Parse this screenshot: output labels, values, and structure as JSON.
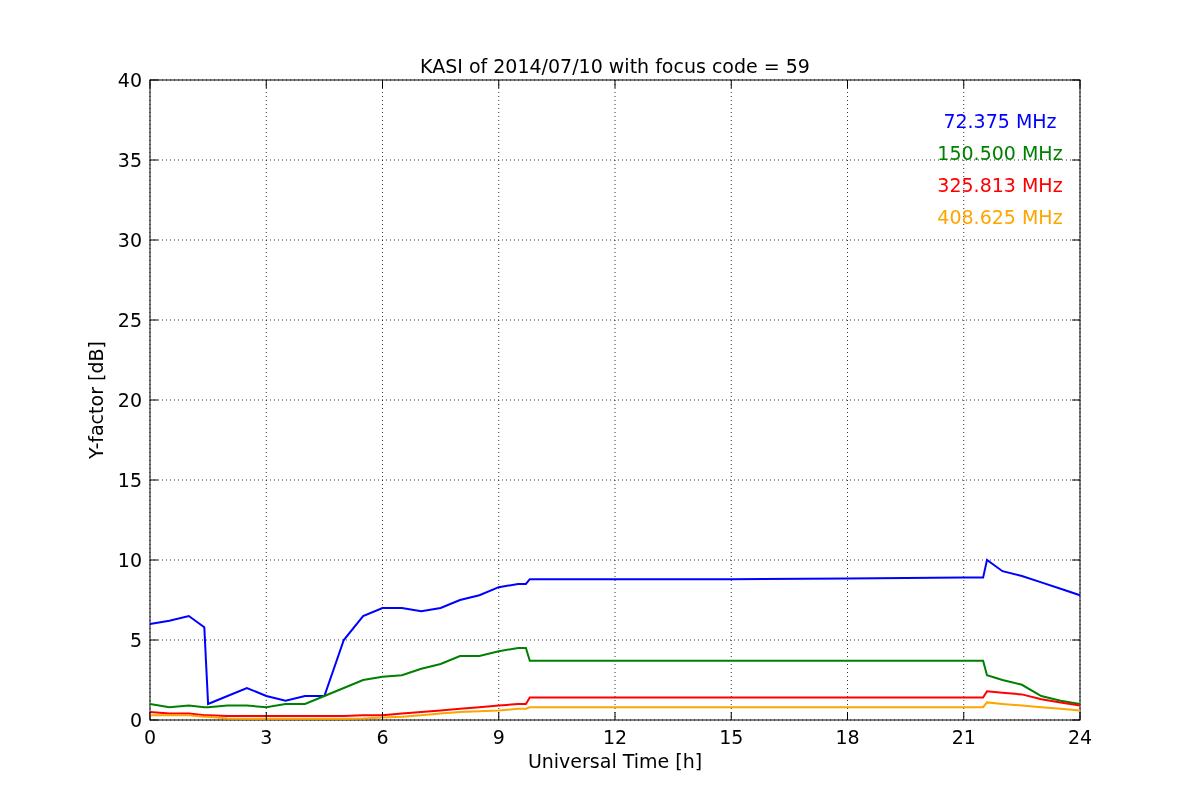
{
  "chart_data": {
    "type": "line",
    "title": "KASI of 2014/07/10 with focus code = 59",
    "xlabel": "Universal Time [h]",
    "ylabel": "Y-factor [dB]",
    "x": [
      0,
      0.5,
      1,
      1.4,
      1.5,
      2,
      2.5,
      3,
      3.5,
      4,
      4.5,
      5,
      5.5,
      6,
      6.5,
      7,
      7.5,
      8,
      8.5,
      9,
      9.5,
      9.7,
      9.8,
      12,
      15,
      18,
      21,
      21.5,
      21.6,
      22,
      22.5,
      23,
      23.5,
      24
    ],
    "series": [
      {
        "name": "72.375 MHz",
        "color": "#0000ff",
        "values": [
          6,
          6.2,
          6.5,
          5.8,
          1,
          1.5,
          2,
          1.5,
          1.2,
          1.5,
          1.5,
          5,
          6.5,
          7,
          7,
          6.8,
          7,
          7.5,
          7.8,
          8.3,
          8.5,
          8.5,
          8.8,
          8.8,
          8.8,
          8.85,
          8.9,
          8.9,
          10,
          9.3,
          9,
          8.6,
          8.2,
          7.8
        ]
      },
      {
        "name": "150.500 MHz",
        "color": "#008000",
        "values": [
          1,
          0.8,
          0.9,
          0.8,
          0.8,
          0.9,
          0.9,
          0.8,
          1,
          1,
          1.5,
          2,
          2.5,
          2.7,
          2.8,
          3.2,
          3.5,
          4,
          4,
          4.3,
          4.5,
          4.5,
          3.7,
          3.7,
          3.7,
          3.7,
          3.7,
          3.7,
          2.8,
          2.5,
          2.2,
          1.5,
          1.2,
          1
        ]
      },
      {
        "name": "325.813 MHz",
        "color": "#ff0000",
        "values": [
          0.5,
          0.4,
          0.4,
          0.3,
          0.3,
          0.25,
          0.25,
          0.25,
          0.25,
          0.25,
          0.25,
          0.25,
          0.3,
          0.3,
          0.4,
          0.5,
          0.6,
          0.7,
          0.8,
          0.9,
          1,
          1,
          1.4,
          1.4,
          1.4,
          1.4,
          1.4,
          1.4,
          1.8,
          1.7,
          1.6,
          1.3,
          1.1,
          0.9
        ]
      },
      {
        "name": "408.625 MHz",
        "color": "#ffa500",
        "values": [
          0.3,
          0.3,
          0.3,
          0.2,
          0.2,
          0.1,
          0.08,
          0.08,
          0.08,
          0.08,
          0.08,
          0.08,
          0.1,
          0.15,
          0.2,
          0.3,
          0.4,
          0.5,
          0.55,
          0.6,
          0.7,
          0.7,
          0.8,
          0.8,
          0.8,
          0.8,
          0.8,
          0.8,
          1.1,
          1,
          0.9,
          0.8,
          0.7,
          0.6
        ]
      }
    ],
    "grid": true,
    "xlim": [
      0,
      24
    ],
    "ylim": [
      0,
      40
    ],
    "xticks": [
      0,
      3,
      6,
      9,
      12,
      15,
      18,
      21,
      24
    ],
    "yticks": [
      0,
      5,
      10,
      15,
      20,
      25,
      30,
      35,
      40
    ]
  }
}
